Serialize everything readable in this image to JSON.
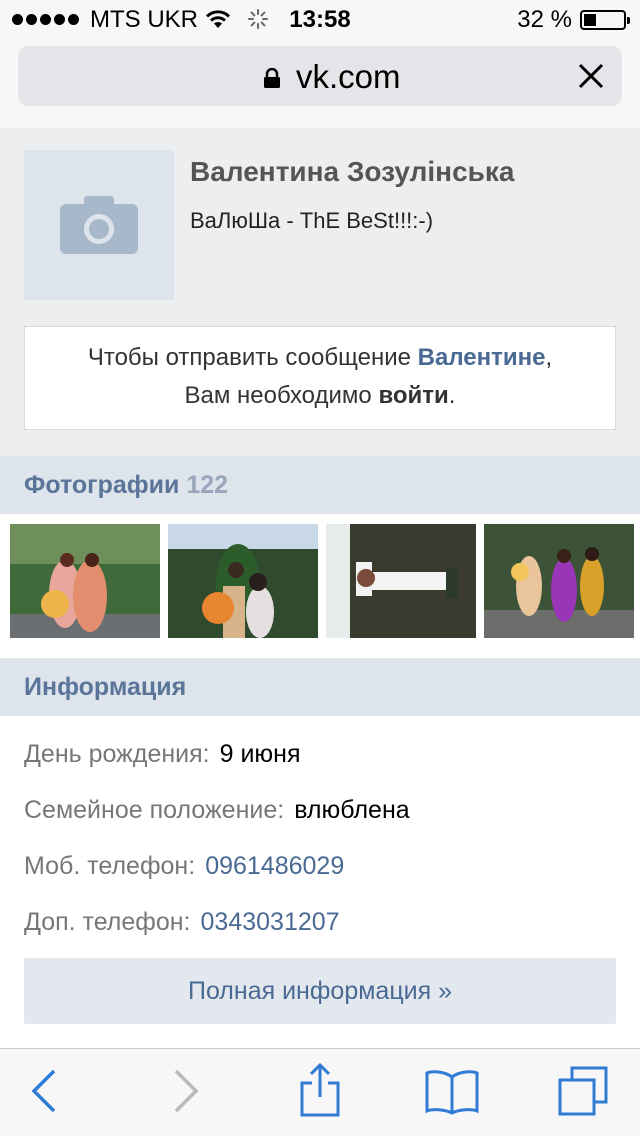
{
  "status_bar": {
    "carrier": "MTS UKR",
    "time": "13:58",
    "battery_percent": "32 %",
    "battery_level": 0.32,
    "signal_bars": 5
  },
  "browser": {
    "url": "vk.com",
    "load_progress": 0.36,
    "icons": [
      "lock-icon",
      "close-icon"
    ]
  },
  "profile": {
    "name": "Валентина Зозулінська",
    "status": "ВаЛюШа - ThE BeSt!!!:-)",
    "avatar_icon": "camera-icon",
    "message": {
      "prefix": "Чтобы отправить сообщение",
      "recipient": "Валентине",
      "comma": ",",
      "line2_prefix": "Вам необходимо",
      "login": "войти",
      "period": "."
    }
  },
  "photos": {
    "title": "Фотографии",
    "count": "122",
    "items": [
      "photo-1",
      "photo-2",
      "photo-3",
      "photo-4"
    ]
  },
  "info": {
    "title": "Информация",
    "rows": [
      {
        "label": "День рождения:",
        "value": "9 июня"
      },
      {
        "label": "Семейное положение:",
        "value": "влюблена"
      },
      {
        "label": "Моб. телефон:",
        "value": "0961486029"
      },
      {
        "label": "Доп. телефон:",
        "value": "0343031207"
      }
    ],
    "full_button": "Полная информация »"
  },
  "toolbar": {
    "icons": [
      "back-icon",
      "forward-icon",
      "share-icon",
      "bookmarks-icon",
      "tabs-icon"
    ]
  },
  "colors": {
    "link_blue": "#4a6a93",
    "header_bg": "#dde4ec",
    "progress_blue": "#2f7bd6"
  }
}
